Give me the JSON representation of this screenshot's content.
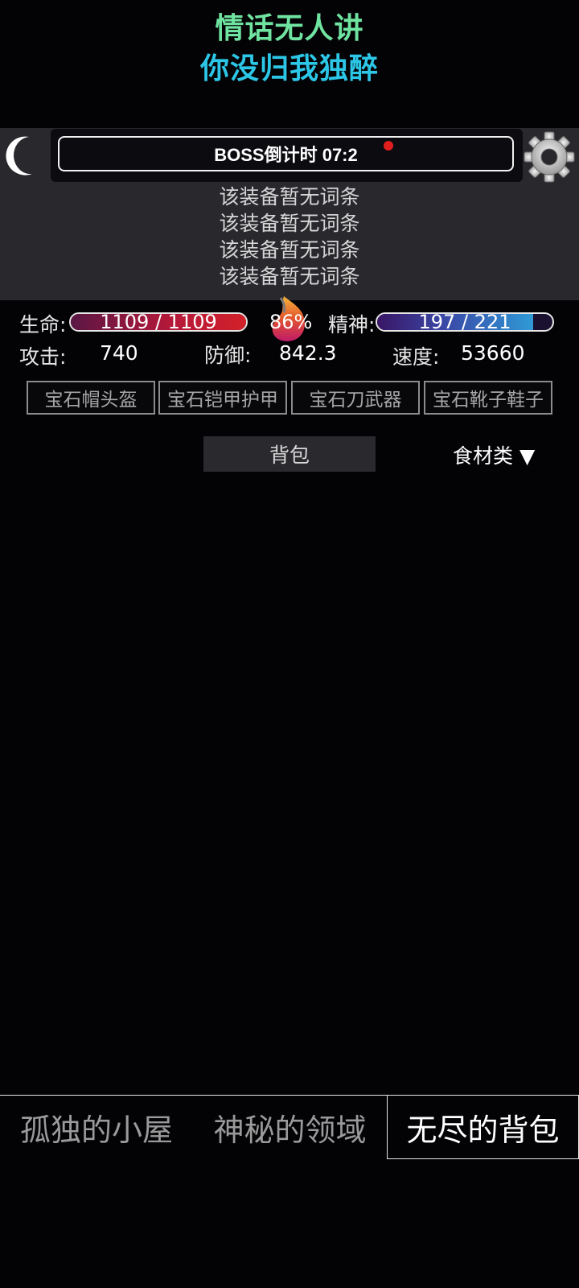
{
  "lyrics": {
    "line1": "情话无人讲",
    "line2": "你没归我独醉"
  },
  "boss": {
    "timer": "BOSS倒计时 07:2"
  },
  "affixes": [
    "该装备暂无词条",
    "该装备暂无词条",
    "该装备暂无词条",
    "该装备暂无词条"
  ],
  "stats": {
    "hp_label": "生命:",
    "hp_text": "1109 / 1109",
    "hp_fraction": 1.0,
    "percent": "86%",
    "sp_label": "精神:",
    "sp_text": "197 / 221",
    "sp_fraction": 0.891,
    "atk_label": "攻击:",
    "atk_value": "740",
    "def_label": "防御:",
    "def_value": "842.3",
    "spd_label": "速度:",
    "spd_value": "53660"
  },
  "gem_buttons": [
    "宝石帽头盔",
    "宝石铠甲护甲",
    "宝石刀武器",
    "宝石靴子鞋子"
  ],
  "bag": {
    "tab_label": "背包",
    "category": "食材类 ▼"
  },
  "nav": {
    "items": [
      "孤独的小屋",
      "神秘的领域",
      "无尽的背包"
    ],
    "active": 2
  },
  "icons": {
    "moon": "crescent-moon-icon",
    "gear": "gear-icon",
    "flame": "flame-icon",
    "dot": "notification-dot"
  },
  "colors": {
    "background": "#030205",
    "lyric1": "#6fe3a0",
    "lyric2": "#2cc6e6",
    "hp": "#d3212a",
    "sp": "#2f9ad6",
    "alert": "#e01e1e"
  }
}
